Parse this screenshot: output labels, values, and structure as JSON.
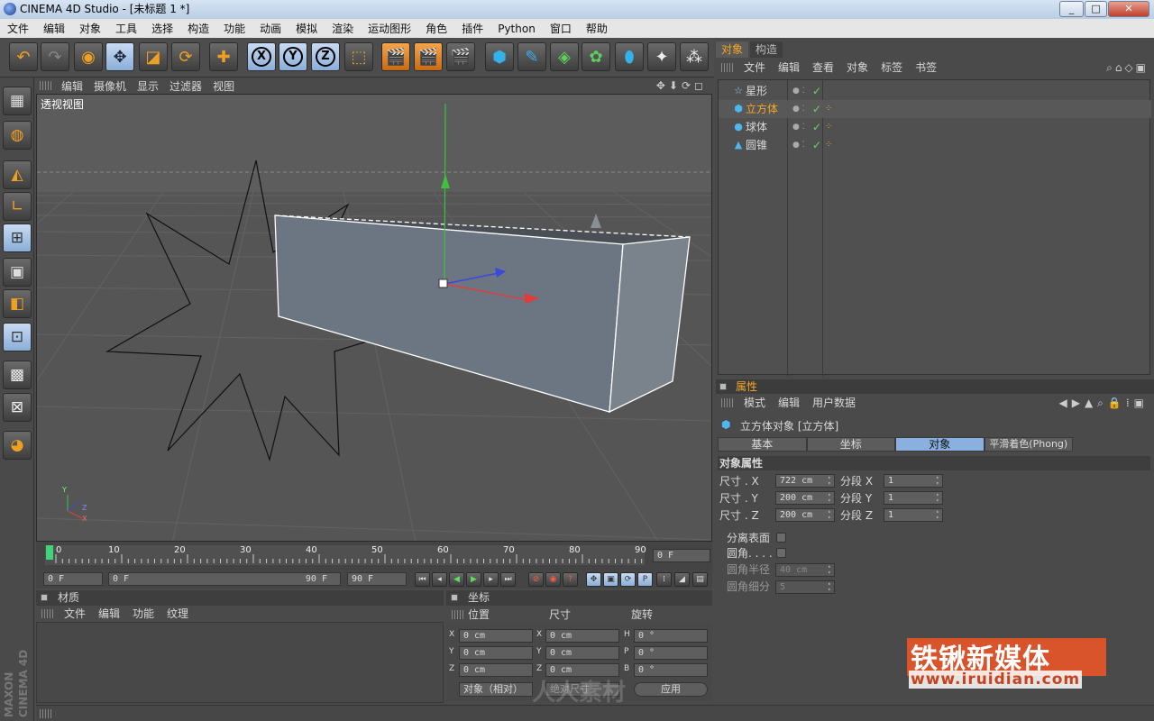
{
  "window": {
    "title": "CINEMA 4D Studio - [未标题 1 *]",
    "min": "_",
    "max": "□",
    "close": "✕"
  },
  "menubar": [
    "文件",
    "编辑",
    "对象",
    "工具",
    "选择",
    "构造",
    "功能",
    "动画",
    "模拟",
    "渲染",
    "运动图形",
    "角色",
    "插件",
    "Python",
    "窗口",
    "帮助"
  ],
  "viewport": {
    "menu": [
      "编辑",
      "摄像机",
      "显示",
      "过滤器",
      "视图"
    ],
    "label": "透视视图",
    "axis_labels": [
      "Y",
      "Z",
      "X"
    ]
  },
  "timeline": {
    "ticks": [
      "0",
      "10",
      "20",
      "30",
      "40",
      "50",
      "60",
      "70",
      "80",
      "90"
    ],
    "current_frame": "0 F",
    "start": "0 F",
    "range_start": "0 F",
    "range_end": "90 F",
    "end": "90 F"
  },
  "materials": {
    "title": "材质",
    "menu": [
      "文件",
      "编辑",
      "功能",
      "纹理"
    ]
  },
  "coordinates": {
    "title": "坐标",
    "columns": [
      "位置",
      "尺寸",
      "旋转"
    ],
    "rows": [
      {
        "axis1": "X",
        "pos": "0 cm",
        "axis2": "X",
        "size": "0 cm",
        "axis3": "H",
        "rot": "0 °"
      },
      {
        "axis1": "Y",
        "pos": "0 cm",
        "axis2": "Y",
        "size": "0 cm",
        "axis3": "P",
        "rot": "0 °"
      },
      {
        "axis1": "Z",
        "pos": "0 cm",
        "axis2": "Z",
        "size": "0 cm",
        "axis3": "B",
        "rot": "0 °"
      }
    ],
    "mode_label": "对象（相对）",
    "size_mode": "绝对尺寸",
    "apply": "应用"
  },
  "object_manager": {
    "tabs": [
      "对象",
      "构造"
    ],
    "menu": [
      "文件",
      "编辑",
      "查看",
      "对象",
      "标签",
      "书签"
    ],
    "objects": [
      {
        "name": "星形",
        "icon": "☆",
        "selected": false
      },
      {
        "name": "立方体",
        "icon": "⬢",
        "selected": true
      },
      {
        "name": "球体",
        "icon": "●",
        "selected": false
      },
      {
        "name": "圆锥",
        "icon": "▲",
        "selected": false
      }
    ],
    "check": "✓"
  },
  "attributes": {
    "title": "属性",
    "menu": [
      "模式",
      "编辑",
      "用户数据"
    ],
    "object_title": "立方体对象 [立方体]",
    "tabs": [
      "基本",
      "坐标",
      "对象",
      "平滑着色(Phong)"
    ],
    "active_tab": "对象",
    "section": "对象属性",
    "size_rows": [
      {
        "label": "尺寸 . X",
        "value": "722 cm",
        "seg_label": "分段 X",
        "seg": "1"
      },
      {
        "label": "尺寸 . Y",
        "value": "200 cm",
        "seg_label": "分段 Y",
        "seg": "1"
      },
      {
        "label": "尺寸 . Z",
        "value": "200 cm",
        "seg_label": "分段 Z",
        "seg": "1"
      }
    ],
    "separate": "分离表面",
    "fillet": "圆角. . . .",
    "fillet_radius_label": "圆角半径",
    "fillet_radius": "40 cm",
    "fillet_sub_label": "圆角细分",
    "fillet_sub": "5"
  },
  "sidebar_logo": "MAXON CINEMA 4D",
  "watermark": {
    "text": "铁锹新媒体",
    "url": "www.iruidian.com",
    "ghost": "人人素材"
  },
  "colors": {
    "accent": "#f5a623",
    "selected_blue": "#8ab0e0",
    "background": "#4a4a4a"
  }
}
